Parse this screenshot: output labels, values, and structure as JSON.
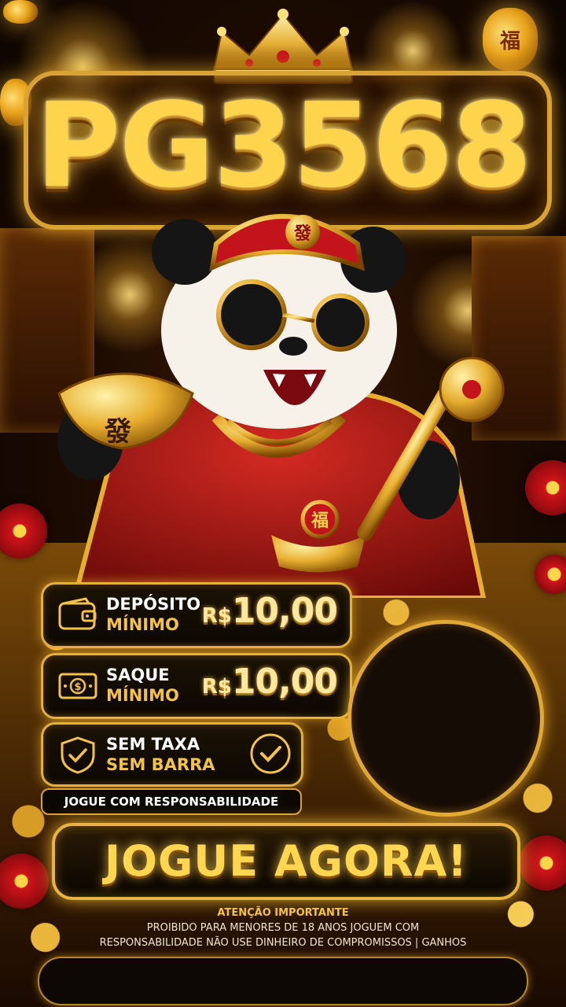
{
  "brand": {
    "title": "PG3568"
  },
  "panels": [
    {
      "id": "deposit",
      "icon": "wallet-icon",
      "line1": "DEPÓSITO",
      "line2": "MÍNIMO",
      "currency": "R$",
      "value": "10,00"
    },
    {
      "id": "withdraw",
      "icon": "cash-icon",
      "line1": "SAQUE",
      "line2": "MÍNIMO",
      "currency": "R$",
      "value": "10,00"
    },
    {
      "id": "no-fee",
      "icon": "shield-check-icon",
      "line1": "SEM TAXA",
      "line2": "SEM BARRA",
      "badge_icon": "check-circle-icon"
    }
  ],
  "responsibility": "JOGUE COM RESPONSABILIDADE",
  "cta": {
    "label": "JOGUE AGORA!"
  },
  "notice": {
    "heading": "ATENÇÃO IMPORTANTE",
    "line1": "PROIBIDO PARA MENORES DE 18 ANOS JOGUEM COM",
    "line2": "RESPONSABILIDADE NÃO USE DINHEIRO DE COMPROMISSOS | GANHOS"
  },
  "decor": {
    "lantern_glyph": "福",
    "hat_glyph": "發",
    "ingot_glyph": "發",
    "pendant_glyph": "福"
  },
  "colors": {
    "gold": "#e3b03c",
    "accent": "#ffd44d",
    "red": "#c4141b",
    "background": "#1a0a02"
  }
}
